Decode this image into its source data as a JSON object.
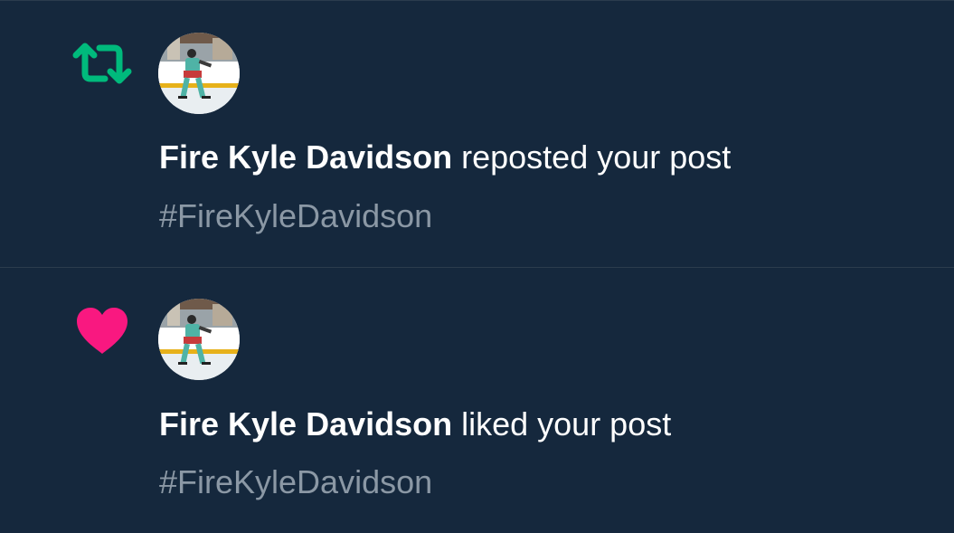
{
  "colors": {
    "background": "#15283d",
    "divider": "#2b3c4d",
    "repost_icon": "#00ba7c",
    "like_icon": "#f91880",
    "primary_text": "#ffffff",
    "secondary_text": "#8b98a5"
  },
  "notifications": [
    {
      "type": "repost",
      "icon": "repost-icon",
      "avatar": "hockey-player-avatar",
      "user_name": "Fire Kyle Davidson",
      "action_text": " reposted your post",
      "preview_text": "#FireKyleDavidson"
    },
    {
      "type": "like",
      "icon": "heart-icon",
      "avatar": "hockey-player-avatar",
      "user_name": "Fire Kyle Davidson",
      "action_text": " liked your post",
      "preview_text": "#FireKyleDavidson"
    }
  ]
}
